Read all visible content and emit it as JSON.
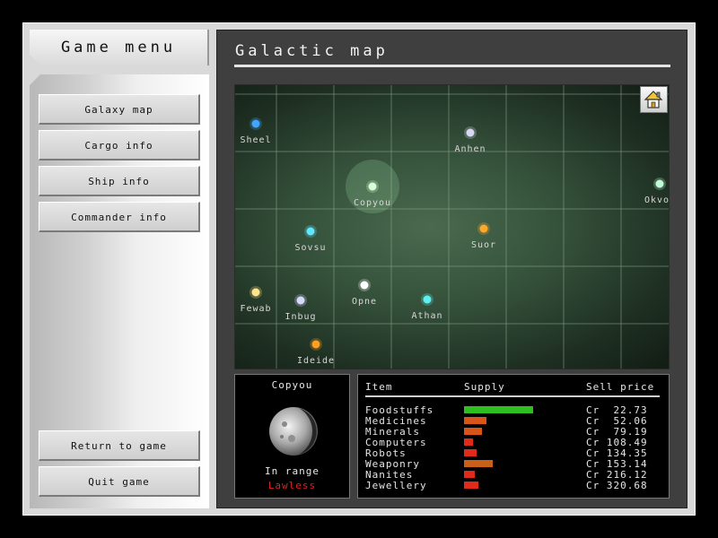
{
  "menu": {
    "title": "Game menu",
    "buttons": [
      "Galaxy map",
      "Cargo info",
      "Ship info",
      "Commander info"
    ],
    "bottom_buttons": [
      "Return to game",
      "Quit game"
    ]
  },
  "panel": {
    "title": "Galactic map"
  },
  "map": {
    "stars": [
      {
        "name": "Sheel",
        "color": "#3ea6ff"
      },
      {
        "name": "Anhen",
        "color": "#d8d8f0"
      },
      {
        "name": "Okvo",
        "color": "#bfffd8"
      },
      {
        "name": "Copyou",
        "color": "#d6ffd6"
      },
      {
        "name": "Sovsu",
        "color": "#5fe8ff"
      },
      {
        "name": "Suor",
        "color": "#ffa82a"
      },
      {
        "name": "Fewab",
        "color": "#ffe58a"
      },
      {
        "name": "Inbug",
        "color": "#d8d8ff"
      },
      {
        "name": "Opne",
        "color": "#ffffff"
      },
      {
        "name": "Athan",
        "color": "#5ff0f0"
      },
      {
        "name": "Ideide",
        "color": "#ffa020"
      }
    ],
    "home_icon": "home-icon"
  },
  "planet": {
    "name": "Copyou",
    "range": "In range",
    "law": "Lawless",
    "law_color": "#e02020"
  },
  "market": {
    "headers": {
      "item": "Item",
      "supply": "Supply",
      "price": "Sell price"
    },
    "rows": [
      {
        "item": "Foodstuffs",
        "supply": 1.0,
        "color": "#2dbf1e",
        "price": "Cr  22.73"
      },
      {
        "item": "Medicines",
        "supply": 0.32,
        "color": "#d8541a",
        "price": "Cr  52.06"
      },
      {
        "item": "Minerals",
        "supply": 0.26,
        "color": "#d8541a",
        "price": "Cr  79.19"
      },
      {
        "item": "Computers",
        "supply": 0.13,
        "color": "#e02a1a",
        "price": "Cr 108.49"
      },
      {
        "item": "Robots",
        "supply": 0.18,
        "color": "#e02a1a",
        "price": "Cr 134.35"
      },
      {
        "item": "Weaponry",
        "supply": 0.42,
        "color": "#c8601a",
        "price": "Cr 153.14"
      },
      {
        "item": "Nanites",
        "supply": 0.15,
        "color": "#e02a1a",
        "price": "Cr 216.12"
      },
      {
        "item": "Jewellery",
        "supply": 0.21,
        "color": "#e02a1a",
        "price": "Cr 320.68"
      }
    ]
  }
}
